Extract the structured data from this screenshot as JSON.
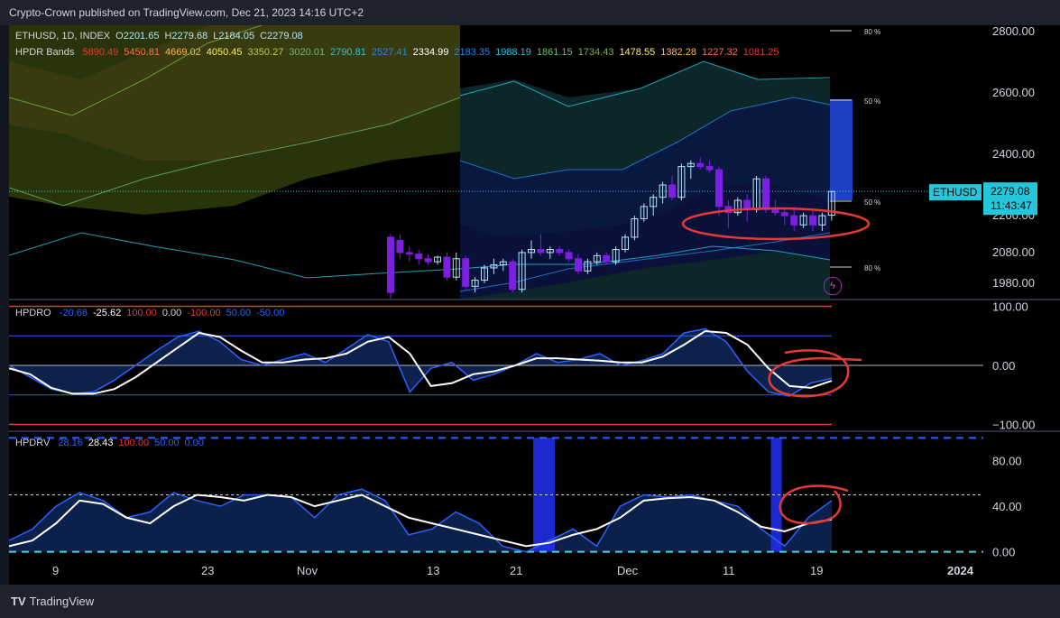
{
  "header": {
    "published_line": "Crypto-Crown published on TradingView.com, Dec 21, 2023 14:16 UTC+2"
  },
  "footer": {
    "brand": "TradingView"
  },
  "symbol_line": {
    "symbol": "ETHUSD, 1D, INDEX",
    "o_label": "O",
    "o": "2201.65",
    "h_label": "H",
    "h": "2279.68",
    "l_label": "L",
    "l": "2184.05",
    "c_label": "C",
    "c": "2279.08"
  },
  "hpdr_bands": {
    "label": "HPDR Bands",
    "values": [
      {
        "text": "5890.49",
        "color": "#e53935"
      },
      {
        "text": "5450.81",
        "color": "#ff7043"
      },
      {
        "text": "4669.02",
        "color": "#ffb74d"
      },
      {
        "text": "4050.45",
        "color": "#ffee58"
      },
      {
        "text": "3350.27",
        "color": "#c0ca33"
      },
      {
        "text": "3020.01",
        "color": "#66bb6a"
      },
      {
        "text": "2790.81",
        "color": "#26c6da"
      },
      {
        "text": "2527.41",
        "color": "#1e88e5"
      },
      {
        "text": "2334.99",
        "color": "#ffffff"
      },
      {
        "text": "2183.35",
        "color": "#1e88e5"
      },
      {
        "text": "1988.19",
        "color": "#26c6da"
      },
      {
        "text": "1861.15",
        "color": "#66bb6a"
      },
      {
        "text": "1734.43",
        "color": "#7cb342"
      },
      {
        "text": "1478.55",
        "color": "#ffee58"
      },
      {
        "text": "1382.28",
        "color": "#ffb74d"
      },
      {
        "text": "1227.32",
        "color": "#ff7043"
      },
      {
        "text": "1081.25",
        "color": "#e53935"
      }
    ]
  },
  "band_labels": [
    "80 %",
    "50 %",
    "50 %",
    "80 %"
  ],
  "price_tag": {
    "symbol": "ETHUSD",
    "price": "2279.08",
    "countdown": "11:43:47"
  },
  "hpdro_legend": {
    "label": "HPDRO",
    "values": [
      {
        "text": "-20.68",
        "color": "#2962ff"
      },
      {
        "text": "-25.62",
        "color": "#ffffff"
      },
      {
        "text": "100.00",
        "color": "#e53935"
      },
      {
        "text": "0.00",
        "color": "#d1d4dc"
      },
      {
        "text": "-100.00",
        "color": "#e53935"
      },
      {
        "text": "50.00",
        "color": "#2962ff"
      },
      {
        "text": "-50.00",
        "color": "#2962ff"
      }
    ]
  },
  "hpdrv_legend": {
    "label": "HPDRV",
    "values": [
      {
        "text": "28.16",
        "color": "#2962ff"
      },
      {
        "text": "28.43",
        "color": "#ffffff"
      },
      {
        "text": "100.00",
        "color": "#e53935"
      },
      {
        "text": "50.00",
        "color": "#2962ff"
      },
      {
        "text": "0.00",
        "color": "#2962ff"
      }
    ]
  },
  "colors": {
    "up": "#b3e5fc",
    "down": "#7c1fe0",
    "accent": "#26c6da",
    "annotation": "#e53935"
  },
  "chart_data": [
    {
      "type": "candlestick",
      "title": "ETHUSD, 1D, INDEX",
      "xlabel": "",
      "ylabel": "",
      "x_ticks": [
        "9",
        "23",
        "Nov",
        "13",
        "21",
        "Dec",
        "11",
        "19",
        "2024"
      ],
      "y_ticks": [
        "1980.00",
        "2080.00",
        "2200.00",
        "2400.00",
        "2600.00",
        "2800.00"
      ],
      "ylim": [
        1930,
        2820
      ],
      "candles_from": "2023-11-09",
      "candles": [
        [
          2130,
          2140,
          1920,
          1950
        ],
        [
          2120,
          2140,
          2060,
          2080
        ],
        [
          2080,
          2100,
          2050,
          2075
        ],
        [
          2075,
          2090,
          2040,
          2060
        ],
        [
          2060,
          2075,
          2040,
          2050
        ],
        [
          2050,
          2070,
          2040,
          2065
        ],
        [
          2065,
          2080,
          1990,
          2000
        ],
        [
          2000,
          2080,
          1990,
          2060
        ],
        [
          2060,
          2070,
          1960,
          1970
        ],
        [
          1970,
          2000,
          1950,
          1990
        ],
        [
          1990,
          2040,
          1980,
          2030
        ],
        [
          2030,
          2060,
          2010,
          2040
        ],
        [
          2040,
          2060,
          2020,
          2050
        ],
        [
          2050,
          2060,
          1950,
          1960
        ],
        [
          1960,
          2090,
          1950,
          2080
        ],
        [
          2080,
          2120,
          2060,
          2090
        ],
        [
          2090,
          2140,
          2070,
          2080
        ],
        [
          2080,
          2100,
          2060,
          2090
        ],
        [
          2090,
          2100,
          2070,
          2080
        ],
        [
          2080,
          2090,
          2050,
          2060
        ],
        [
          2060,
          2075,
          2010,
          2020
        ],
        [
          2020,
          2060,
          2010,
          2050
        ],
        [
          2050,
          2080,
          2040,
          2070
        ],
        [
          2070,
          2080,
          2040,
          2050
        ],
        [
          2050,
          2100,
          2040,
          2090
        ],
        [
          2090,
          2140,
          2080,
          2130
        ],
        [
          2130,
          2200,
          2120,
          2190
        ],
        [
          2190,
          2240,
          2180,
          2230
        ],
        [
          2230,
          2270,
          2200,
          2260
        ],
        [
          2260,
          2310,
          2240,
          2300
        ],
        [
          2300,
          2330,
          2250,
          2260
        ],
        [
          2260,
          2370,
          2250,
          2360
        ],
        [
          2360,
          2380,
          2320,
          2370
        ],
        [
          2370,
          2390,
          2350,
          2360
        ],
        [
          2360,
          2380,
          2340,
          2350
        ],
        [
          2350,
          2360,
          2200,
          2230
        ],
        [
          2230,
          2250,
          2160,
          2210
        ],
        [
          2210,
          2260,
          2200,
          2250
        ],
        [
          2250,
          2270,
          2180,
          2220
        ],
        [
          2220,
          2330,
          2210,
          2320
        ],
        [
          2320,
          2330,
          2210,
          2220
        ],
        [
          2220,
          2250,
          2200,
          2210
        ],
        [
          2210,
          2220,
          2170,
          2200
        ],
        [
          2200,
          2230,
          2150,
          2170
        ],
        [
          2170,
          2210,
          2160,
          2200
        ],
        [
          2200,
          2220,
          2150,
          2170
        ],
        [
          2170,
          2210,
          2150,
          2200
        ],
        [
          2201.65,
          2279.68,
          2184.05,
          2279.08
        ]
      ],
      "last_price": 2279.08
    },
    {
      "type": "line",
      "title": "HPDRO",
      "ylim": [
        -110,
        110
      ],
      "y_ticks": [
        "100.00",
        "0.00",
        "−100.00"
      ],
      "levels": [
        100,
        50,
        0,
        -50,
        -100
      ],
      "series": [
        {
          "values": [
            0,
            -20,
            -40,
            -48,
            -45,
            -25,
            0,
            25,
            48,
            58,
            40,
            10,
            0,
            10,
            20,
            5,
            28,
            52,
            40,
            -45,
            -5,
            5,
            -25,
            -15,
            0,
            20,
            5,
            10,
            20,
            0,
            8,
            20,
            55,
            62,
            40,
            -10,
            -45,
            -52,
            -30,
            -22
          ]
        },
        {
          "values": [
            -5,
            -15,
            -38,
            -48,
            -48,
            -40,
            -20,
            5,
            30,
            55,
            48,
            25,
            5,
            5,
            10,
            12,
            20,
            40,
            48,
            20,
            -35,
            -30,
            -15,
            -10,
            0,
            12,
            12,
            10,
            8,
            5,
            5,
            15,
            35,
            58,
            55,
            35,
            -5,
            -35,
            -38,
            -26
          ]
        }
      ]
    },
    {
      "type": "area",
      "title": "HPDRV",
      "ylim": [
        -5,
        105
      ],
      "y_ticks": [
        "80.00",
        "40.00",
        "0.00"
      ],
      "levels": [
        100,
        50,
        0
      ],
      "series": [
        {
          "values": [
            10,
            20,
            40,
            52,
            45,
            30,
            35,
            52,
            45,
            40,
            50,
            50,
            48,
            30,
            50,
            55,
            45,
            15,
            20,
            35,
            25,
            5,
            0,
            10,
            20,
            5,
            40,
            50,
            48,
            50,
            45,
            40,
            20,
            5,
            30,
            45
          ]
        },
        {
          "values": [
            5,
            10,
            25,
            45,
            42,
            30,
            25,
            40,
            50,
            48,
            45,
            50,
            48,
            40,
            45,
            50,
            40,
            30,
            25,
            20,
            15,
            10,
            5,
            8,
            15,
            20,
            30,
            45,
            47,
            48,
            45,
            35,
            22,
            18,
            25,
            28.43
          ]
        }
      ],
      "highlight_bars": [
        {
          "x_frac": 0.538,
          "value": 100
        },
        {
          "x_frac": 0.782,
          "value": 100
        }
      ]
    }
  ]
}
